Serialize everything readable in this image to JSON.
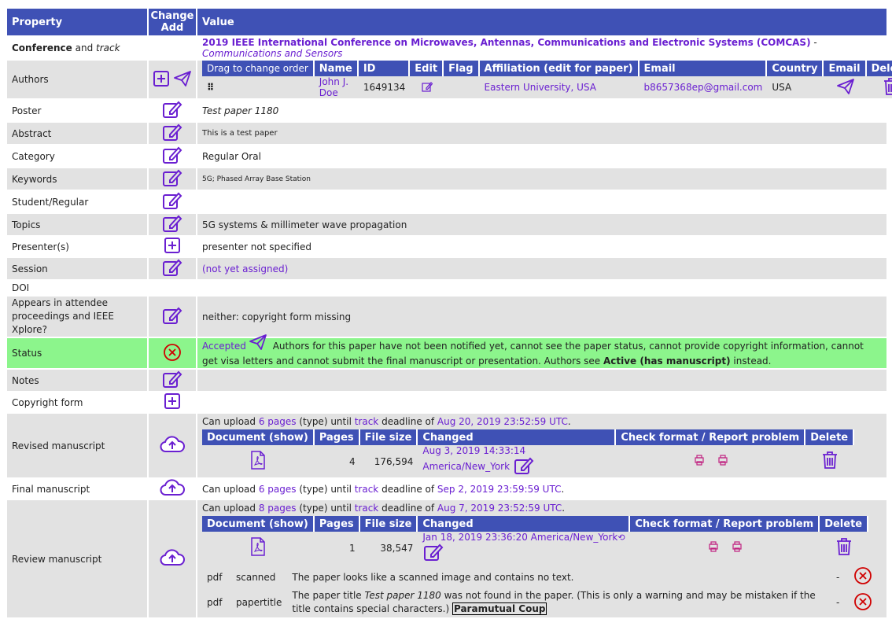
{
  "header": {
    "property": "Property",
    "change": "Change",
    "add": "Add",
    "value": "Value"
  },
  "conference": {
    "label_bold": "Conference",
    "label_and": " and ",
    "label_track": "track",
    "name": "2019 IEEE International Conference on Microwaves, Antennas, Communications and Electronic Systems (COMCAS)",
    "sep": " - ",
    "track": "Communications and Sensors"
  },
  "authors": {
    "label": "Authors",
    "columns": [
      "Drag to change order",
      "Name",
      "ID",
      "Edit",
      "Flag",
      "Affiliation (edit for paper)",
      "Email",
      "Country",
      "Email",
      "Delete"
    ],
    "rows": [
      {
        "name": "John J. Doe",
        "id": "1649134",
        "affiliation": "Eastern University, USA",
        "email": "b8657368ep@gmail.com",
        "country": "USA"
      }
    ]
  },
  "poster": {
    "label": "Poster",
    "value": "Test paper 1180"
  },
  "abstract": {
    "label": "Abstract",
    "value": "This is a test paper"
  },
  "category": {
    "label": "Category",
    "value": "Regular Oral"
  },
  "keywords": {
    "label": "Keywords",
    "value": "5G; Phased Array Base Station"
  },
  "student": {
    "label": "Student/Regular",
    "value": ""
  },
  "topics": {
    "label": "Topics",
    "value": "5G systems & millimeter wave propagation"
  },
  "presenters": {
    "label": "Presenter(s)",
    "value": "presenter not specified"
  },
  "session": {
    "label": "Session",
    "value": "(not yet assigned)"
  },
  "doi": {
    "label": "DOI",
    "value": ""
  },
  "appears": {
    "label": "Appears in attendee proceedings and IEEE Xplore?",
    "value": "neither: copyright form missing"
  },
  "status": {
    "label": "Status",
    "accepted": "Accepted",
    "text1": " Authors for this paper have not been notified yet, cannot see the paper status, cannot provide copyright information, cannot get visa letters and cannot submit the final manuscript or presentation. Authors see ",
    "bold": "Active (has manuscript)",
    "text2": " instead."
  },
  "notes": {
    "label": "Notes"
  },
  "copyright": {
    "label": "Copyright form"
  },
  "doc_columns": [
    "Document (show)",
    "Pages",
    "File size",
    "Changed",
    "Check format / Report problem",
    "Delete"
  ],
  "revised": {
    "label": "Revised manuscript",
    "upload": {
      "t1": "Can upload ",
      "pages": "6 pages",
      "t2": " (type) until ",
      "track": "track",
      "t3": " deadline of ",
      "deadline": "Aug 20, 2019 23:52:59 UTC",
      "t4": "."
    },
    "doc": {
      "pages": "4",
      "size": "176,594",
      "changed": "Aug 3, 2019 14:33:14 America/New_York"
    }
  },
  "final": {
    "label": "Final manuscript",
    "upload": {
      "t1": "Can upload ",
      "pages": "6 pages",
      "t2": " (type) until ",
      "track": "track",
      "t3": " deadline of ",
      "deadline": "Sep 2, 2019 23:59:59 UTC",
      "t4": "."
    }
  },
  "review": {
    "label": "Review manuscript",
    "upload": {
      "t1": "Can upload ",
      "pages": "8 pages",
      "t2": " (type) until ",
      "track": "track",
      "t3": " deadline of ",
      "deadline": "Aug 7, 2019 23:52:59 UTC",
      "t4": "."
    },
    "doc": {
      "pages": "1",
      "size": "38,547",
      "changed": "Jan 18, 2019 23:36:20 America/New_York"
    },
    "warnings": [
      {
        "type": "pdf",
        "code": "scanned",
        "msg": "The paper looks like a scanned image and contains no text.",
        "dash": "-"
      },
      {
        "type": "pdf",
        "code": "papertitle",
        "msg1": "The paper title ",
        "title": "Test paper 1180",
        "msg2": " was not found in the paper. (This is only a warning and may be mistaken if the title contains special characters.) ",
        "found": "Paramutual Coup",
        "dash": "-"
      }
    ]
  },
  "colors": {
    "header": "#3f51b5",
    "accent": "#6a1fd1",
    "row_alt": "#e2e2e2",
    "status_bg": "#8cf58c",
    "error": "#d00000"
  }
}
